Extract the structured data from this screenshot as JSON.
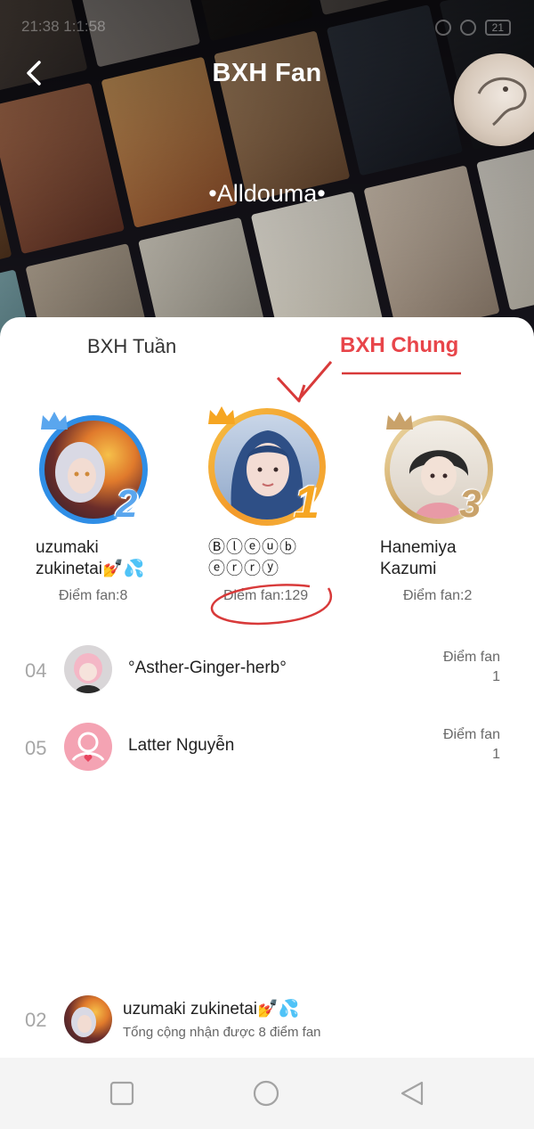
{
  "status": {
    "time": "21:38 1:1:58",
    "battery": "21"
  },
  "header": {
    "title": "BXH Fan",
    "community": "•Alldouma•"
  },
  "tabs": {
    "weekly": "BXH Tuần",
    "overall": "BXH Chung",
    "active": "overall"
  },
  "podium": [
    {
      "rank": "2",
      "name_line1": "uzumaki",
      "name_line2": "zukinetai💅💦",
      "score": "Điểm fan:8",
      "ring_color": "#2f8ee6",
      "rank_color": "#5aa6ee"
    },
    {
      "rank": "1",
      "name_line1": "Ⓑⓛⓔⓤⓑ",
      "name_line2": "ⓔⓡⓡⓨ",
      "score": "Điểm fan:129",
      "ring_color": "#f39a2a",
      "rank_color": "#f6a622"
    },
    {
      "rank": "3",
      "name_line1": "Hanemiya",
      "name_line2": "Kazumi",
      "score": "Điểm fan:2",
      "ring_color": "#c89c55",
      "rank_color": "#c9a26a"
    }
  ],
  "list": [
    {
      "rank": "04",
      "name": "°Asther-Ginger-herb°",
      "score_label": "Điểm fan",
      "score": "1"
    },
    {
      "rank": "05",
      "name": "Latter Nguyễn",
      "score_label": "Điểm fan",
      "score": "1"
    }
  ],
  "my_rank": {
    "rank": "02",
    "name": "uzumaki zukinetai💅💦",
    "subtitle": "Tổng cộng nhận được 8 điểm fan"
  },
  "colors": {
    "accent": "#e8454a",
    "annotation": "#d83a3a"
  },
  "icons": {
    "back": "chevron-left-icon",
    "nav_recent": "square-icon",
    "nav_home": "circle-icon",
    "nav_back": "triangle-back-icon"
  }
}
